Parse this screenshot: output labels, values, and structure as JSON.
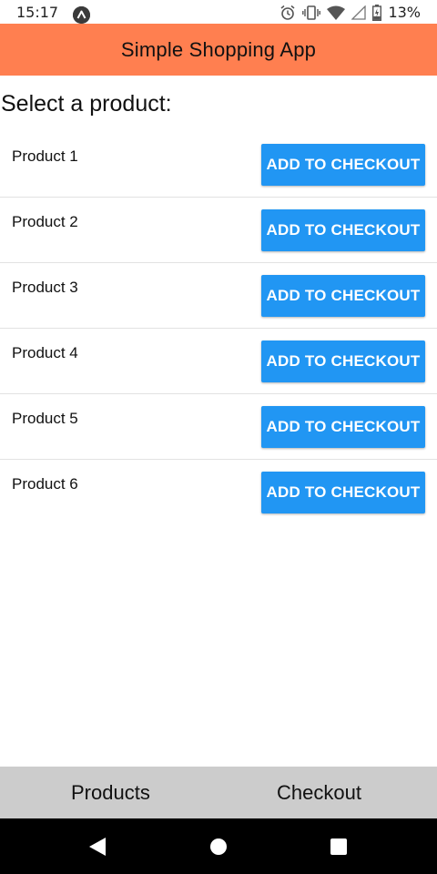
{
  "status_bar": {
    "time": "15:17",
    "battery": "13%",
    "icons": [
      "notification-icon",
      "alarm-icon",
      "vibrate-icon",
      "wifi-icon",
      "signal-icon",
      "battery-icon"
    ]
  },
  "app_bar": {
    "title": "Simple Shopping App",
    "color": "#ff7f50"
  },
  "main": {
    "heading": "Select a product:",
    "products": [
      {
        "name": "Product 1",
        "button": "ADD TO CHECKOUT"
      },
      {
        "name": "Product 2",
        "button": "ADD TO CHECKOUT"
      },
      {
        "name": "Product 3",
        "button": "ADD TO CHECKOUT"
      },
      {
        "name": "Product 4",
        "button": "ADD TO CHECKOUT"
      },
      {
        "name": "Product 5",
        "button": "ADD TO CHECKOUT"
      },
      {
        "name": "Product 6",
        "button": "ADD TO CHECKOUT"
      }
    ],
    "button_color": "#2196f3"
  },
  "tabs": [
    {
      "label": "Products"
    },
    {
      "label": "Checkout"
    }
  ],
  "nav_bar": {
    "icons": [
      "back-icon",
      "home-icon",
      "recents-icon"
    ]
  }
}
